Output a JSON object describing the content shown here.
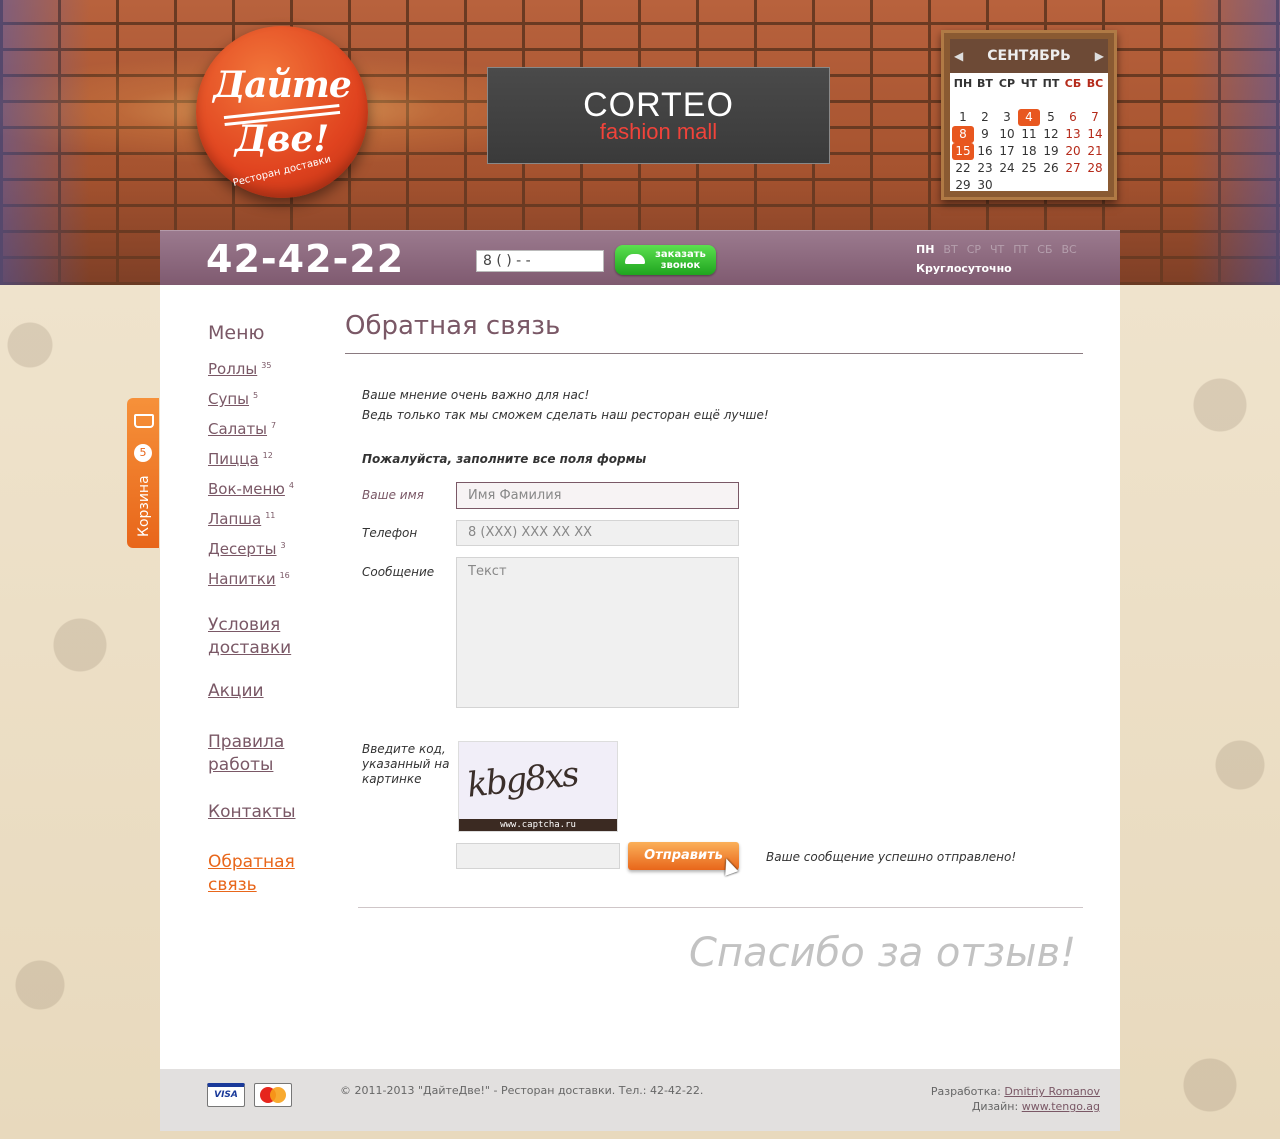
{
  "logo": {
    "line1": "Дайте",
    "line2": "Две!",
    "subtitle": "Ресторан доставки"
  },
  "banner": {
    "brand": "CORTEO",
    "tagline": "fashion mall"
  },
  "calendar": {
    "month": "СЕНТЯБРЬ",
    "weekdays": [
      "ПН",
      "ВТ",
      "СР",
      "ЧТ",
      "ПТ",
      "СБ",
      "ВС"
    ],
    "days": [
      "",
      "",
      "",
      "",
      "",
      "",
      "",
      "1",
      "2",
      "3",
      "4",
      "5",
      "6",
      "7",
      "8",
      "9",
      "10",
      "11",
      "12",
      "13",
      "14",
      "15",
      "16",
      "17",
      "18",
      "19",
      "20",
      "21",
      "22",
      "23",
      "24",
      "25",
      "26",
      "27",
      "28",
      "29",
      "30"
    ],
    "highlighted": [
      "4",
      "8",
      "15"
    ],
    "colors": {
      "highlight": "#e8571f",
      "weekend": "#b52a1a"
    }
  },
  "header": {
    "phone": "42-42-22",
    "callback_input_value": "8 (    )      -   -",
    "callback_button": "заказать звонок",
    "days": [
      "ПН",
      "ВТ",
      "СР",
      "ЧТ",
      "ПТ",
      "СБ",
      "ВС"
    ],
    "active_day": "ПН",
    "hours": "Круглосуточно"
  },
  "cart": {
    "label": "Корзина",
    "count": "5"
  },
  "sidebar": {
    "title": "Меню",
    "items": [
      {
        "label": "Роллы",
        "count": "35"
      },
      {
        "label": "Супы",
        "count": "5"
      },
      {
        "label": "Салаты",
        "count": "7"
      },
      {
        "label": "Пицца",
        "count": "12"
      },
      {
        "label": "Вок-меню",
        "count": "4"
      },
      {
        "label": "Лапша",
        "count": "11"
      },
      {
        "label": "Десерты",
        "count": "3"
      },
      {
        "label": "Напитки",
        "count": "16"
      }
    ],
    "nav": [
      {
        "label": "Условия доставки"
      },
      {
        "label": "Акции"
      },
      {
        "label": "Правила работы"
      },
      {
        "label": "Контакты"
      },
      {
        "label": "Обратная связь",
        "active": true
      }
    ]
  },
  "main": {
    "title": "Обратная связь",
    "intro_line1": "Ваше мнение очень важно для нас!",
    "intro_line2": "Ведь только так мы сможем сделать наш ресторан ещё лучше!",
    "form_note": "Пожалуйста, заполните все поля формы",
    "name_label": "Ваше имя",
    "name_placeholder": "Имя Фамилия",
    "phone_label": "Телефон",
    "phone_placeholder": "8 (XXX) XXX XX XX",
    "message_label": "Сообщение",
    "message_placeholder": "Текст",
    "captcha_label": "Введите код, указанный на картинке",
    "captcha_code": "kbg8xs",
    "captcha_site": "www.captcha.ru",
    "send_button": "Отправить",
    "success": "Ваше сообщение успешно отправлено!",
    "thanks": "Спасибо за отзыв!"
  },
  "footer": {
    "cards": [
      "VISA",
      "MasterCard"
    ],
    "copyright": "© 2011-2013 \"ДайтеДве!\" - Ресторан доставки.  Тел.: 42-42-22.",
    "dev_label": "Разработка:",
    "dev_name": "Dmitriy Romanov",
    "design_label": "Дизайн:",
    "design_link": "www.tengo.ag"
  }
}
